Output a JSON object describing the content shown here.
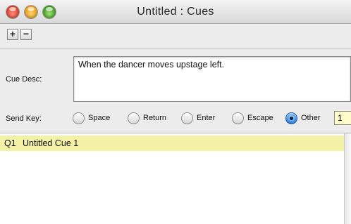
{
  "window": {
    "title": "Untitled : Cues",
    "buttons": [
      "close",
      "minimize",
      "zoom"
    ]
  },
  "toolbar": {
    "add_label": "+",
    "remove_label": "−"
  },
  "cue_desc": {
    "label": "Cue Desc:",
    "value": "When the dancer moves upstage left."
  },
  "send_key": {
    "label": "Send Key:",
    "options": [
      "Space",
      "Return",
      "Enter",
      "Escape",
      "Other"
    ],
    "selected": "Other",
    "other_value": "1"
  },
  "cues": [
    {
      "number": "Q1",
      "name": "Untitled Cue 1",
      "selected": true
    }
  ],
  "colors": {
    "selected_row": "#f3f1a6",
    "other_field": "#fffbc8"
  },
  "icons": {
    "add": "plus-icon",
    "remove": "minus-icon"
  }
}
